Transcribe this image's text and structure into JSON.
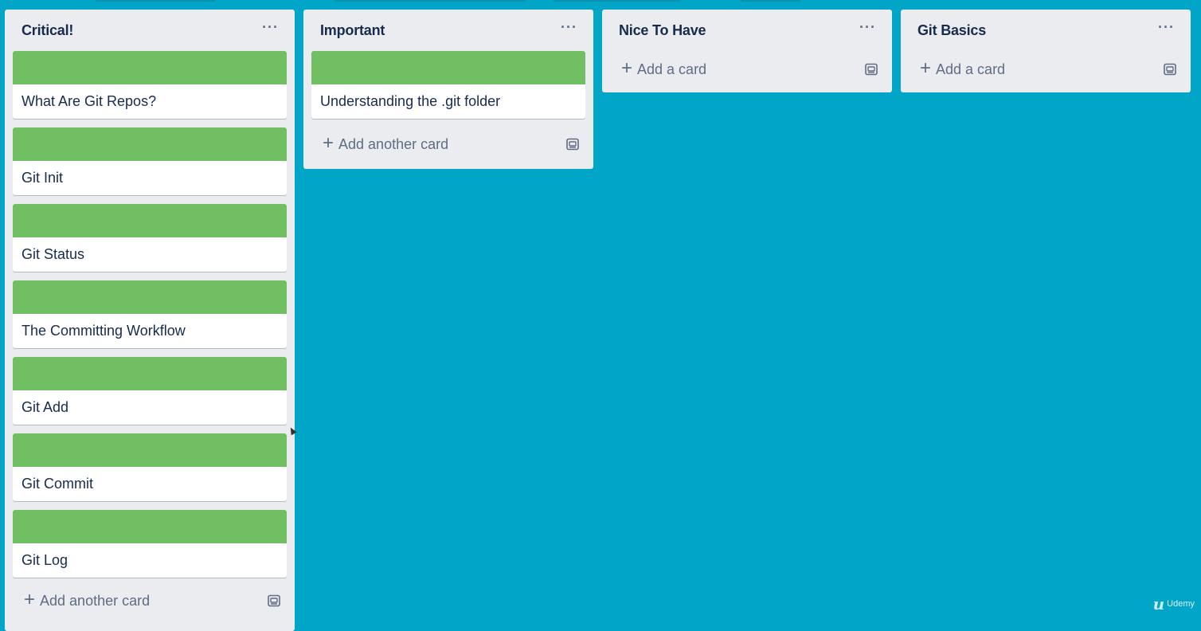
{
  "board": {
    "background_color": "#01a5c8",
    "label_color": "#70bf63",
    "lists": [
      {
        "title": "Critical!",
        "menu_icon": "more-horizontal-icon",
        "menu_label": "···",
        "cards": [
          {
            "title": "What Are Git Repos?",
            "label_color": "green"
          },
          {
            "title": "Git Init",
            "label_color": "green"
          },
          {
            "title": "Git Status",
            "label_color": "green"
          },
          {
            "title": "The Committing Workflow",
            "label_color": "green"
          },
          {
            "title": "Git Add",
            "label_color": "green"
          },
          {
            "title": "Git Commit",
            "label_color": "green"
          },
          {
            "title": "Git Log",
            "label_color": "green"
          }
        ],
        "add_label": "Add another card",
        "template_icon": "card-template-icon"
      },
      {
        "title": "Important",
        "menu_icon": "more-horizontal-icon",
        "menu_label": "···",
        "cards": [
          {
            "title": "Understanding the .git folder",
            "label_color": "green"
          }
        ],
        "add_label": "Add another card",
        "template_icon": "card-template-icon"
      },
      {
        "title": "Nice To Have",
        "menu_icon": "more-horizontal-icon",
        "menu_label": "···",
        "cards": [],
        "add_label": "Add a card",
        "template_icon": "card-template-icon"
      },
      {
        "title": "Git Basics",
        "menu_icon": "more-horizontal-icon",
        "menu_label": "···",
        "cards": [],
        "add_label": "Add a card",
        "template_icon": "card-template-icon"
      }
    ]
  },
  "watermark": {
    "mark": "u",
    "text": "Udemy"
  }
}
